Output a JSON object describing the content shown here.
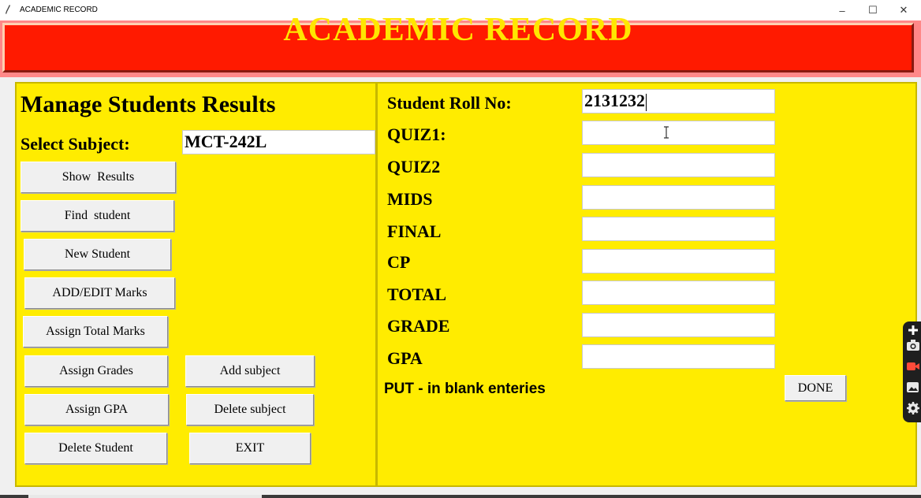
{
  "window": {
    "title": "ACADEMIC RECORD",
    "minimize_glyph": "–",
    "maximize_glyph": "☐",
    "close_glyph": "✕",
    "app_icon": "feather-icon"
  },
  "header": {
    "title": "ACADEMIC RECORD",
    "bg_color": "#ff1a00",
    "text_color": "#ffe600"
  },
  "left_panel": {
    "heading": "Manage Students Results",
    "subject_label": "Select Subject:",
    "subject_value": "MCT-242L",
    "buttons": {
      "show_results": "Show  Results",
      "find_student": "Find  student",
      "new_student": "New Student",
      "add_edit_marks": "ADD/EDIT Marks",
      "assign_total_marks": "Assign Total Marks",
      "assign_grades": "Assign Grades",
      "assign_gpa": "Assign GPA",
      "delete_student": "Delete Student",
      "add_subject": "Add subject",
      "delete_subject": "Delete subject",
      "exit": "EXIT"
    }
  },
  "right_panel": {
    "fields": {
      "roll_no": {
        "label": "Student Roll No:",
        "value": "2131232"
      },
      "quiz1": {
        "label": "QUIZ1:",
        "value": ""
      },
      "quiz2": {
        "label": "QUIZ2",
        "value": ""
      },
      "mids": {
        "label": "MIDS",
        "value": ""
      },
      "final": {
        "label": "FINAL",
        "value": ""
      },
      "cp": {
        "label": "CP",
        "value": ""
      },
      "total": {
        "label": "TOTAL",
        "value": ""
      },
      "grade": {
        "label": "GRADE",
        "value": ""
      },
      "gpa": {
        "label": "GPA",
        "value": ""
      }
    },
    "note": "PUT - in blank enteries",
    "done_button": "DONE"
  },
  "panel_color": "#ffec00",
  "side_toolbar": {
    "icons": [
      "plus-icon",
      "camera-icon",
      "video-icon",
      "gallery-icon",
      "settings-icon"
    ]
  }
}
